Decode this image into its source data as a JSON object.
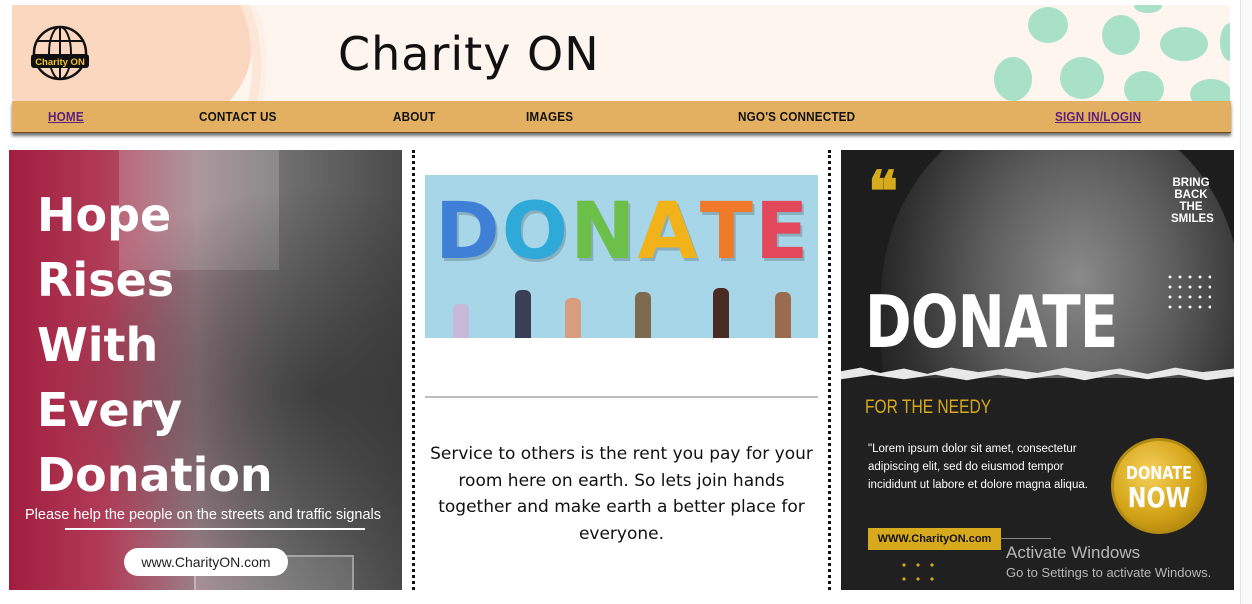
{
  "header": {
    "logo_text": "Charity ON",
    "title": "Charity ON"
  },
  "nav": {
    "items": [
      {
        "label": "HOME"
      },
      {
        "label": "CONTACT US"
      },
      {
        "label": "ABOUT"
      },
      {
        "label": "IMAGES"
      },
      {
        "label": "NGO'S CONNECTED"
      },
      {
        "label": "SIGN IN/LOGIN"
      }
    ]
  },
  "left_panel": {
    "headline_lines": [
      "Hope",
      "Rises",
      "With",
      "Every",
      "Donation"
    ],
    "subtext": "Please help the people on the streets and traffic signals",
    "url": "www.CharityON.com"
  },
  "middle_panel": {
    "banner_word": "DONATE",
    "quote": "Service to others is the rent you pay for your room here on earth. So lets join hands together and make earth a better place for everyone."
  },
  "right_panel": {
    "quote_mark": "❝",
    "tagline_lines": [
      "BRING",
      "BACK",
      "THE",
      "SMILES"
    ],
    "headline": "DONATE",
    "subheadline": "FOR THE NEEDY",
    "body": "\"Lorem ipsum dolor sit amet, consectetur adipiscing elit, sed do eiusmod tempor incididunt ut labore et dolore magna aliqua.",
    "url": "WWW.CharityON.com",
    "badge_line1": "DONATE",
    "badge_line2": "NOW"
  },
  "watermark": {
    "line1": "Activate Windows",
    "line2": "Go to Settings to activate Windows."
  },
  "colors": {
    "nav_bg": "#e3b062",
    "accent_gold": "#d7a91c",
    "link_purple": "#5b1e7a",
    "header_bg": "#fdf5ee"
  }
}
